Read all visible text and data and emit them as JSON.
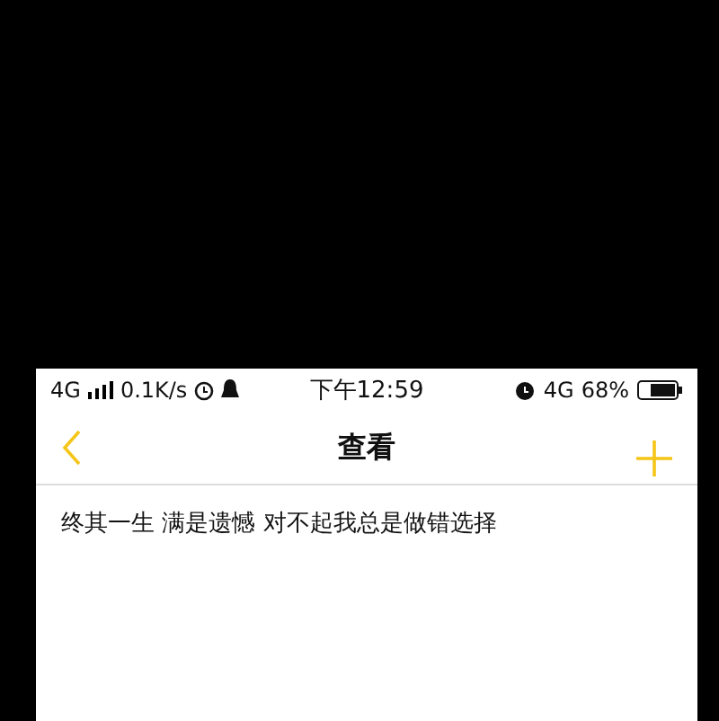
{
  "status_bar": {
    "network": "4G",
    "speed": "0.1K/s",
    "time": "下午12:59",
    "network_right": "4G",
    "battery": "68%"
  },
  "nav_bar": {
    "title": "查看"
  },
  "content": {
    "text": "终其一生 满是遗憾 对不起我总是做错选择"
  }
}
